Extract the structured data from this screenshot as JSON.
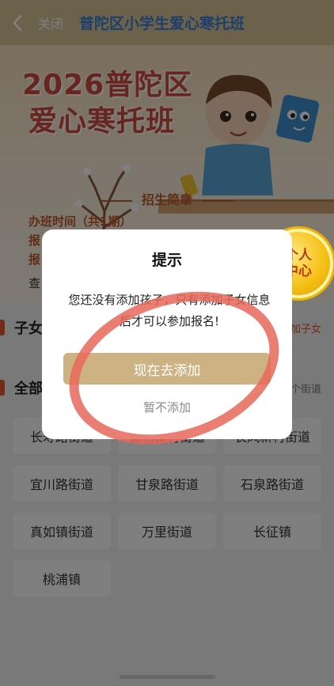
{
  "nav": {
    "close_label": "关闭",
    "title": "普陀区小学生爱心寒托班"
  },
  "banner": {
    "title_line1": "2026普陀区",
    "title_line2": "爱心寒托班",
    "section_title": "招生简章",
    "info_line1": "办班时间（共1期）",
    "info_line2": "报",
    "info_line3": "报",
    "info_line4": "查"
  },
  "badge": {
    "label": "个人中心"
  },
  "sections": {
    "children_label": "子女",
    "children_right": "加子女",
    "all_label": "全部",
    "all_right": "个街道"
  },
  "streets": [
    "长寿路街道",
    "曹杨新村街道",
    "长风新村街道",
    "宜川路街道",
    "甘泉路街道",
    "石泉路街道",
    "真如镇街道",
    "万里街道",
    "长征镇",
    "桃浦镇"
  ],
  "dialog": {
    "title": "提示",
    "message": "您还没有添加孩子，只有添加子女信息后才可以参加报名!",
    "primary_button": "现在去添加",
    "secondary_button": "暂不添加"
  },
  "colors": {
    "nav_bg": "#d8c394",
    "title_blue": "#3c7fd9",
    "primary_button": "#cdb283",
    "accent_red": "#e4572e",
    "annotation_red": "#e8675b"
  }
}
